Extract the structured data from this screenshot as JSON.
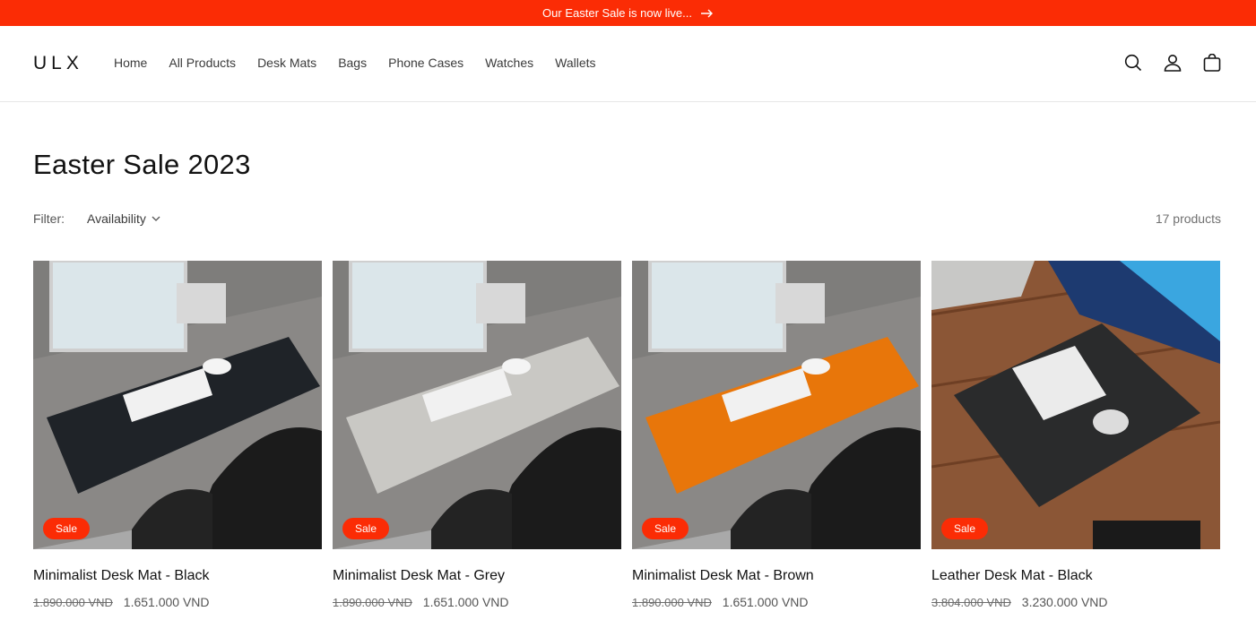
{
  "announcement": {
    "text": "Our Easter Sale is now live..."
  },
  "header": {
    "logo": "ULX",
    "nav": [
      "Home",
      "All Products",
      "Desk Mats",
      "Bags",
      "Phone Cases",
      "Watches",
      "Wallets"
    ]
  },
  "collection": {
    "title": "Easter Sale 2023",
    "filter_label": "Filter:",
    "filter_availability": "Availability",
    "product_count": "17 products"
  },
  "products": [
    {
      "name": "Minimalist Desk Mat - Black",
      "price_old": "1.890.000 VND",
      "price_new": "1.651.000 VND",
      "badge": "Sale",
      "mat_color": "#1f2328"
    },
    {
      "name": "Minimalist Desk Mat - Grey",
      "price_old": "1.890.000 VND",
      "price_new": "1.651.000 VND",
      "badge": "Sale",
      "mat_color": "#c9c8c4"
    },
    {
      "name": "Minimalist Desk Mat - Brown",
      "price_old": "1.890.000 VND",
      "price_new": "1.651.000 VND",
      "badge": "Sale",
      "mat_color": "#e8760a"
    },
    {
      "name": "Leather Desk Mat - Black",
      "price_old": "3.804.000 VND",
      "price_new": "3.230.000 VND",
      "badge": "Sale",
      "mat_color": "#2a2b2c"
    }
  ],
  "colors": {
    "accent": "#fb2c05",
    "text": "#121212"
  }
}
